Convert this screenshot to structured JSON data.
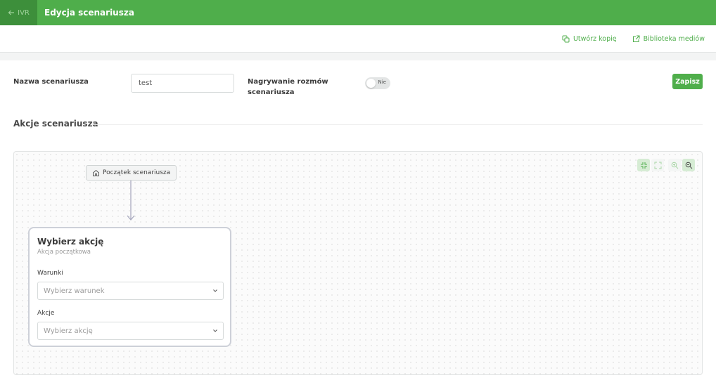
{
  "header": {
    "back_label": "IVR",
    "title": "Edycja scenariusza"
  },
  "toolbar": {
    "copy_label": "Utwórz kopię",
    "media_label": "Biblioteka mediów"
  },
  "form": {
    "name_label": "Nazwa scenariusza",
    "name_value": "test",
    "recording_label_line1": "Nagrywanie rozmów",
    "recording_label_line2": "scenariusza",
    "recording_toggle_text": "Nie",
    "save_label": "Zapisz"
  },
  "actions_section": {
    "title": "Akcje scenariusza"
  },
  "flow": {
    "start_node_label": "Początek scenariusza",
    "action_node": {
      "title": "Wybierz akcję",
      "subtitle": "Akcja początkowa",
      "conditions_label": "Warunki",
      "conditions_placeholder": "Wybierz warunek",
      "actions_label": "Akcje",
      "actions_placeholder": "Wybierz akcję"
    }
  },
  "colors": {
    "brand_green": "#4fae4b",
    "brand_green_dark": "#3d8f3b"
  },
  "icons": {
    "back": "arrow-left-icon",
    "copy": "copy-icon",
    "external": "external-link-icon",
    "home": "home-icon",
    "fit": "fit-view-icon",
    "fullscreen": "fullscreen-icon",
    "zoom_in": "zoom-in-icon",
    "zoom_out": "zoom-out-icon",
    "chevron": "chevron-down-icon"
  }
}
